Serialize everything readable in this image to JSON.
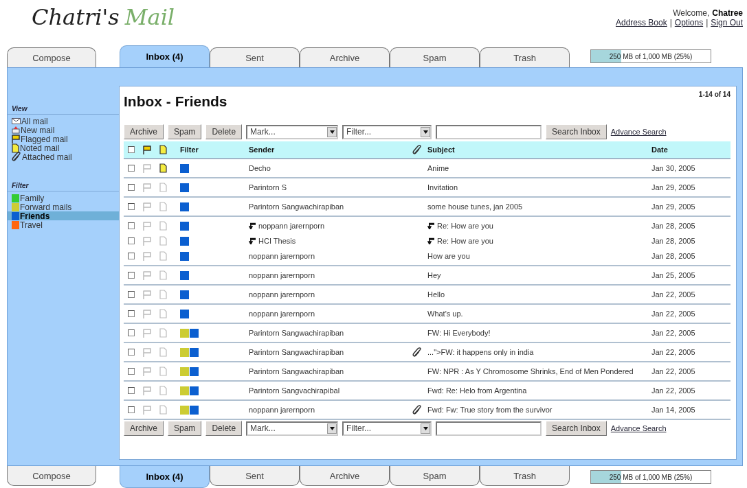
{
  "logo": {
    "name": "Chatri's",
    "product": "Mail"
  },
  "header": {
    "welcome": "Welcome,",
    "user": "Chatree",
    "links": [
      "Address Book",
      "Options",
      "Sign Out"
    ],
    "separator": "|"
  },
  "top_tabs": [
    {
      "label": "Compose",
      "selected": false,
      "kind": "action"
    },
    {
      "label": "Inbox (4)",
      "selected": true,
      "kind": "folder"
    },
    {
      "label": "Sent",
      "selected": false,
      "kind": "folder"
    },
    {
      "label": "Archive",
      "selected": false,
      "kind": "folder"
    },
    {
      "label": "Spam",
      "selected": false,
      "kind": "folder"
    },
    {
      "label": "Trash",
      "selected": false,
      "kind": "folder"
    }
  ],
  "top_storage": {
    "text": "250 MB of 1,000 MB (25%)",
    "level": 0.25
  },
  "sidebar": {
    "view_heading": "View",
    "view_items": [
      {
        "label": "All mail",
        "kind": "all"
      },
      {
        "label": "New mail",
        "kind": "new"
      },
      {
        "label": "Flagged mail",
        "kind": "flagged"
      },
      {
        "label": "Noted mail",
        "kind": "noted"
      },
      {
        "label": "Attached mail",
        "kind": "attached"
      }
    ],
    "filter_heading": "Filter",
    "filter_items": [
      {
        "label": "Family",
        "color": "#33cc33",
        "selected": false
      },
      {
        "label": "Forward mails",
        "color": "#cccc33",
        "selected": false
      },
      {
        "label": "Friends",
        "color": "#0b5fd0",
        "selected": true
      },
      {
        "label": "Travel",
        "color": "#ff6611",
        "selected": false
      }
    ]
  },
  "content": {
    "title": "Inbox - Friends",
    "count": "1-14 of 14",
    "top_toolbar": {
      "buttons": [
        "Archive",
        "Spam",
        "Delete"
      ],
      "mark": "Mark...",
      "filter": "Filter...",
      "search_button": "Search Inbox",
      "advanced": "Advance Search"
    },
    "columns": {
      "select_all_checked": false,
      "filter": "Filter",
      "sender": "Sender",
      "subject": "Subject",
      "date": "Date"
    },
    "threads": [
      {
        "messages": [
          {
            "checked": false,
            "flagged": false,
            "noted": true,
            "filters": [
              {
                "color": "#0b5fd0"
              }
            ],
            "sender": "Decho",
            "attachment": false,
            "reply": false,
            "subject": "Anime",
            "date": "Jan 30, 2005"
          }
        ]
      },
      {
        "messages": [
          {
            "checked": false,
            "flagged": false,
            "noted": false,
            "filters": [
              {
                "color": "#0b5fd0"
              }
            ],
            "sender": "Parintorn S",
            "attachment": false,
            "reply": false,
            "subject": "Invitation",
            "date": "Jan 29, 2005"
          }
        ]
      },
      {
        "messages": [
          {
            "checked": false,
            "flagged": false,
            "noted": false,
            "filters": [
              {
                "color": "#0b5fd0"
              }
            ],
            "sender": "Parintorn Sangwachirapiban",
            "attachment": false,
            "reply": false,
            "subject": "some house tunes, jan 2005",
            "date": "Jan 29, 2005"
          }
        ]
      },
      {
        "messages": [
          {
            "checked": false,
            "flagged": false,
            "noted": false,
            "filters": [
              {
                "color": "#0b5fd0"
              }
            ],
            "sender": "noppann jarernporn",
            "attachment": false,
            "reply": true,
            "subject": "Re: How are you",
            "date": "Jan 28, 2005"
          },
          {
            "checked": false,
            "flagged": false,
            "noted": false,
            "filters": [
              {
                "color": "#0b5fd0"
              }
            ],
            "sender": "HCI Thesis",
            "attachment": false,
            "reply": true,
            "subject": "Re: How are you",
            "date": "Jan 28, 2005"
          },
          {
            "checked": false,
            "flagged": false,
            "noted": false,
            "filters": [
              {
                "color": "#0b5fd0"
              }
            ],
            "sender": "noppann jarernporn",
            "attachment": false,
            "reply": false,
            "subject": "How are you",
            "date": "Jan 28, 2005"
          }
        ]
      },
      {
        "messages": [
          {
            "checked": false,
            "flagged": false,
            "noted": false,
            "filters": [
              {
                "color": "#0b5fd0"
              }
            ],
            "sender": "noppann jarernporn",
            "attachment": false,
            "reply": false,
            "subject": "Hey",
            "date": "Jan 25, 2005"
          }
        ]
      },
      {
        "messages": [
          {
            "checked": false,
            "flagged": false,
            "noted": false,
            "filters": [
              {
                "color": "#0b5fd0"
              }
            ],
            "sender": "noppann jarernporn",
            "attachment": false,
            "reply": false,
            "subject": "Hello",
            "date": "Jan 22, 2005"
          }
        ]
      },
      {
        "messages": [
          {
            "checked": false,
            "flagged": false,
            "noted": false,
            "filters": [
              {
                "color": "#0b5fd0"
              }
            ],
            "sender": "noppann jarernporn",
            "attachment": false,
            "reply": false,
            "subject": "What's up.",
            "date": "Jan 22, 2005"
          }
        ]
      },
      {
        "messages": [
          {
            "checked": false,
            "flagged": false,
            "noted": false,
            "filters": [
              {
                "color": "#cccc33"
              },
              {
                "color": "#0b5fd0"
              }
            ],
            "sender": "Parintorn Sangwachirapiban",
            "attachment": false,
            "reply": false,
            "subject": "FW: Hi Everybody!",
            "date": "Jan 22, 2005"
          }
        ]
      },
      {
        "messages": [
          {
            "checked": false,
            "flagged": false,
            "noted": false,
            "filters": [
              {
                "color": "#cccc33"
              },
              {
                "color": "#0b5fd0"
              }
            ],
            "sender": "Parintorn Sangwachirapiban",
            "attachment": true,
            "reply": false,
            "subject": "...\">FW: it happens only in india",
            "date": "Jan 22, 2005"
          }
        ]
      },
      {
        "messages": [
          {
            "checked": false,
            "flagged": false,
            "noted": false,
            "filters": [
              {
                "color": "#cccc33"
              },
              {
                "color": "#0b5fd0"
              }
            ],
            "sender": "Parintorn Sangwachirapiban",
            "attachment": false,
            "reply": false,
            "subject": "FW: NPR : As Y Chromosome Shrinks, End of Men Pondered",
            "date": "Jan 22, 2005"
          }
        ]
      },
      {
        "messages": [
          {
            "checked": false,
            "flagged": false,
            "noted": false,
            "filters": [
              {
                "color": "#cccc33"
              },
              {
                "color": "#0b5fd0"
              }
            ],
            "sender": "Parintorn Sangvachirapibal",
            "attachment": false,
            "reply": false,
            "subject": "Fwd: Re: Helo from Argentina",
            "date": "Jan 22, 2005"
          }
        ]
      },
      {
        "messages": [
          {
            "checked": false,
            "flagged": false,
            "noted": false,
            "filters": [
              {
                "color": "#cccc33"
              },
              {
                "color": "#0b5fd0"
              }
            ],
            "sender": "noppann jarernporn",
            "attachment": true,
            "reply": false,
            "subject": "Fwd: Fw: True story from the survivor",
            "date": "Jan 14, 2005"
          }
        ]
      }
    ],
    "bottom_toolbar": {
      "buttons": [
        "Archive",
        "Spam",
        "Delete"
      ],
      "mark": "Mark...",
      "filter": "Filter...",
      "search_button": "Search Inbox",
      "advanced": "Advance Search"
    }
  },
  "bottom_tabs": [
    {
      "label": "Compose",
      "selected": false,
      "kind": "action"
    },
    {
      "label": "Inbox (4)",
      "selected": true,
      "kind": "folder"
    },
    {
      "label": "Sent",
      "selected": false,
      "kind": "folder"
    },
    {
      "label": "Archive",
      "selected": false,
      "kind": "folder"
    },
    {
      "label": "Spam",
      "selected": false,
      "kind": "folder"
    },
    {
      "label": "Trash",
      "selected": false,
      "kind": "folder"
    }
  ],
  "bottom_storage": {
    "text": "250 MB of 1,000 MB (25%)",
    "level": 0.25
  }
}
